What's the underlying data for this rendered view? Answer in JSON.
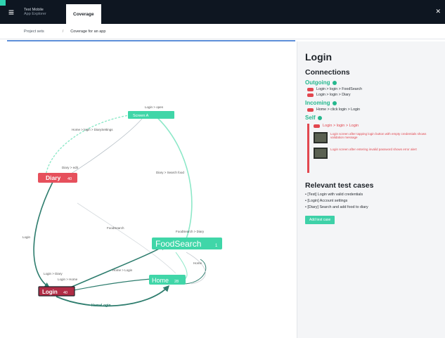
{
  "topbar": {
    "menu_icon": "hamburger-icon",
    "brand_line1": "Test Mobile",
    "brand_line2": "App Explorer",
    "tab_label": "Coverage",
    "close_icon": "close-icon"
  },
  "breadcrumb": {
    "item1": "Project sets",
    "separator": "/",
    "item2": "Coverage for an app"
  },
  "graph": {
    "nodes": [
      {
        "id": "n1",
        "label": "Screen A",
        "sub": "state"
      },
      {
        "id": "n2",
        "label": "Diary",
        "badge": "40"
      },
      {
        "id": "n3",
        "label": "FoodSearch",
        "badge": "1"
      },
      {
        "id": "n4",
        "label": "Home",
        "badge": "28"
      },
      {
        "id": "n5",
        "label": "Login",
        "badge": "40"
      }
    ],
    "edge_labels": {
      "e1": "Login > open",
      "e2": "Home > login > DiarySettings",
      "e3": "Diary > edit",
      "e4": "Diary > Search food",
      "e5": "FoodSearch > Diary",
      "e6": "FoodSearch",
      "e7": "Login",
      "e8": "Home > Login",
      "e9": "Login > Home",
      "e10": "Home",
      "e11": "HomeLogin",
      "e12": "Login > Diary"
    }
  },
  "panel": {
    "title": "Login",
    "connections_title": "Connections",
    "outgoing_label": "Outgoing",
    "outgoing": [
      "Login > login > FoodSearch",
      "Login > login > Diary"
    ],
    "incoming_label": "Incoming",
    "incoming": [
      "Home > click login > Login"
    ],
    "self_label": "Self",
    "self_item": "Login > login > Login",
    "self_shots": [
      "Login screen after tapping login button with empty credentials shows validation message",
      "Login screen after entering invalid password shows error alert"
    ],
    "tests_title": "Relevant test cases",
    "tests": [
      "[Test] Login with valid credentials",
      "[Login] Account settings",
      "[Diary] Search and add food to diary"
    ],
    "add_button": "Add test case"
  },
  "colors": {
    "topbar": "#0e1621",
    "accent": "#2fd3b0",
    "danger": "#e2474f",
    "node_green": "#40d6a8",
    "node_red": "#e6505c",
    "node_dark_red": "#b02c45"
  }
}
